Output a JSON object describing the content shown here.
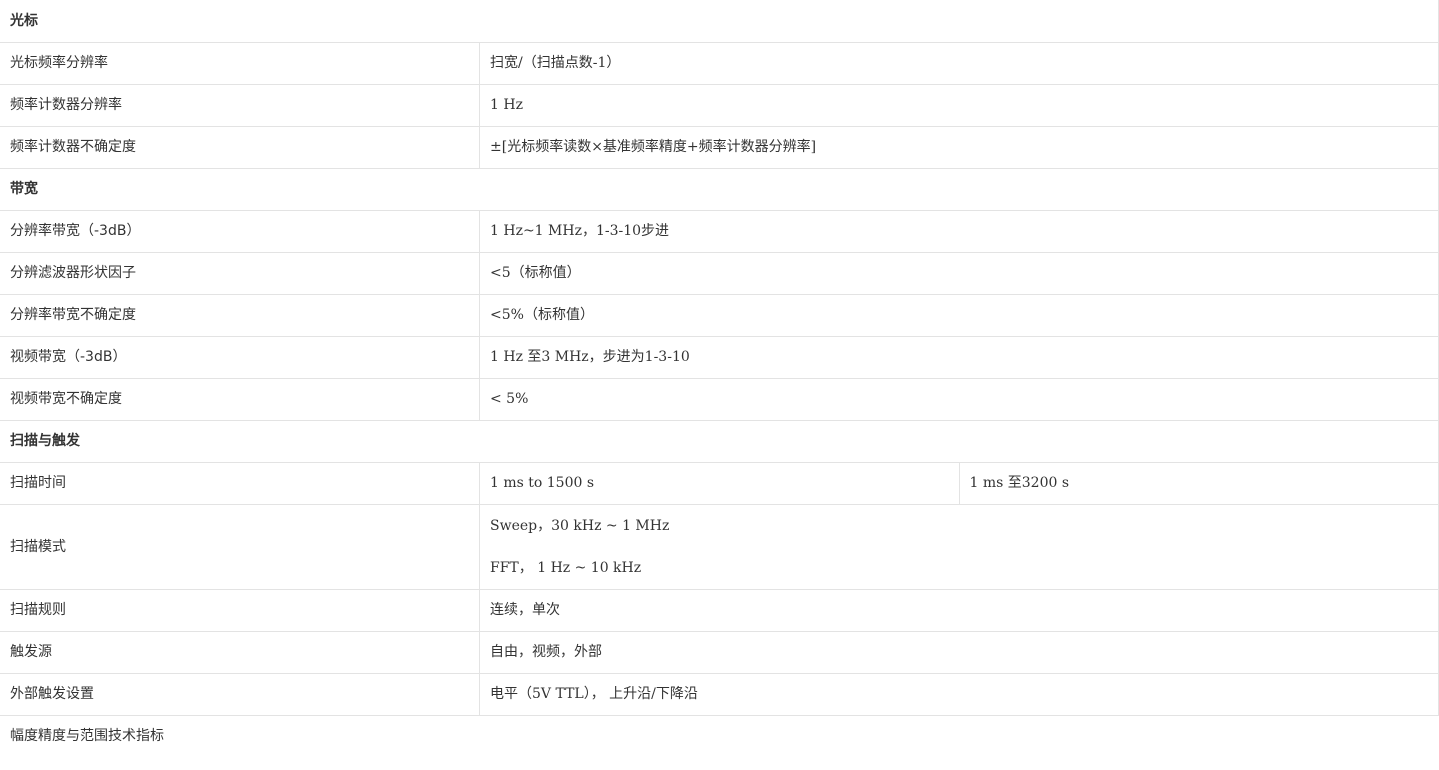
{
  "sections": [
    {
      "title": "光标",
      "rows": [
        {
          "label": "光标频率分辨率",
          "value": "扫宽/（扫描点数-1）"
        },
        {
          "label": "频率计数器分辨率",
          "value": "1 Hz"
        },
        {
          "label": "频率计数器不确定度",
          "value": "±[光标频率读数×基准频率精度+频率计数器分辨率]"
        }
      ]
    },
    {
      "title": "带宽",
      "rows": [
        {
          "label": "分辨率带宽（-3dB）",
          "value": "1 Hz~1 MHz，1-3-10步进"
        },
        {
          "label": "分辨滤波器形状因子",
          "value": "<5（标称值）"
        },
        {
          "label": "分辨率带宽不确定度",
          "value": "<5%（标称值）"
        },
        {
          "label": "视频带宽（-3dB）",
          "value": "1 Hz 至3 MHz，步进为1-3-10"
        },
        {
          "label": "视频带宽不确定度",
          "value": "< 5%"
        }
      ]
    },
    {
      "title": "扫描与触发",
      "rows": [
        {
          "label": "扫描时间",
          "value_a": "1 ms to 1500 s",
          "value_b": "1 ms 至3200 s"
        },
        {
          "label": "扫描模式",
          "value_lines": [
            "Sweep，30 kHz ~ 1 MHz",
            "FFT， 1 Hz ~ 10 kHz"
          ]
        },
        {
          "label": "扫描规则",
          "value": "连续，单次"
        },
        {
          "label": "触发源",
          "value": "自由，视频，外部"
        },
        {
          "label": "外部触发设置",
          "value": "电平（5V TTL）， 上升沿/下降沿"
        }
      ]
    }
  ],
  "footer": {
    "label": "幅度精度与范围技术指标"
  }
}
